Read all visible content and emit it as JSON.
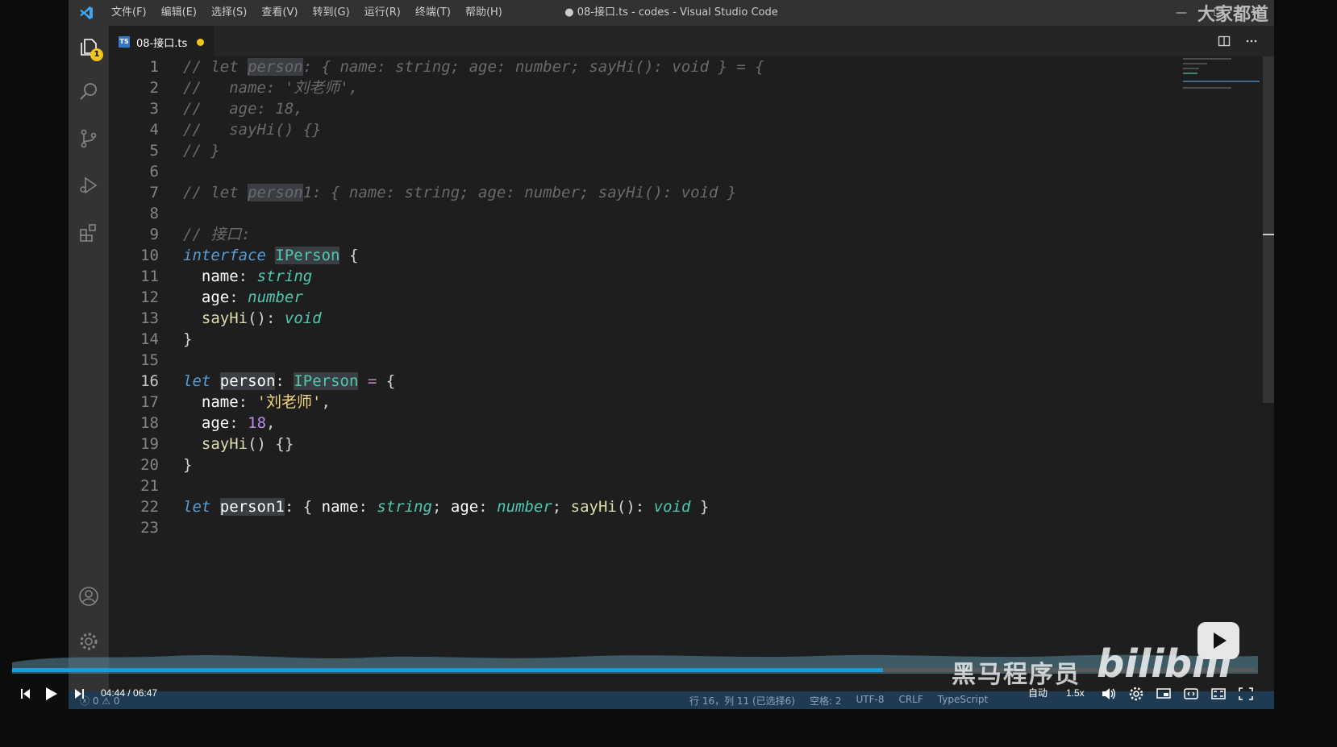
{
  "window": {
    "title": "● 08-接口.ts - codes - Visual Studio Code",
    "menu": [
      "文件(F)",
      "编辑(E)",
      "选择(S)",
      "查看(V)",
      "转到(G)",
      "运行(R)",
      "终端(T)",
      "帮助(H)"
    ],
    "controls": {
      "minimize": "—",
      "restore": "❐",
      "close": "✕"
    }
  },
  "activity_bar": {
    "explorer_badge": "1",
    "items": [
      "files-icon",
      "search-icon",
      "source-control-icon",
      "run-debug-icon",
      "extensions-icon",
      "account-icon",
      "settings-gear-icon"
    ]
  },
  "tab": {
    "filename": "08-接口.ts",
    "file_icon": "TS",
    "modified": true
  },
  "editor": {
    "current_line": 16,
    "line_numbers": [
      "1",
      "2",
      "3",
      "4",
      "5",
      "6",
      "7",
      "8",
      "9",
      "10",
      "11",
      "12",
      "13",
      "14",
      "15",
      "16",
      "17",
      "18",
      "19",
      "20",
      "21",
      "22",
      "23"
    ],
    "lines": {
      "l1": {
        "a": "// let ",
        "b": "person",
        "c": ": { name: string; age: number; sayHi(): void } = {"
      },
      "l2": "//   name: '刘老师',",
      "l3": "//   age: 18,",
      "l4": "//   sayHi() {}",
      "l5": "// }",
      "l7": {
        "a": "// let ",
        "b": "person",
        "c": "1: { name: string; age: number; sayHi(): void }"
      },
      "l9": "// 接口:",
      "l10": {
        "kw": "interface",
        "name": "IPerson",
        "p": "{"
      },
      "l11": {
        "prop": "name",
        "colon": ":",
        "type": "string"
      },
      "l12": {
        "prop": "age",
        "colon": ":",
        "type": "number"
      },
      "l13": {
        "prop": "sayHi",
        "paren": "()",
        "colon": ":",
        "type": "void"
      },
      "l14": "}",
      "l16": {
        "kw": "let",
        "var": "person",
        "colon": ":",
        "type": "IPerson",
        "eq": "=",
        "brace": "{"
      },
      "l17": {
        "prop": "name",
        "colon": ":",
        "value": "'刘老师'",
        "comma": ","
      },
      "l18": {
        "prop": "age",
        "colon": ":",
        "value": "18",
        "comma": ","
      },
      "l19": {
        "fn": "sayHi",
        "rest": "() {}"
      },
      "l20": "}",
      "l22": {
        "kw": "let",
        "var": "person1",
        "c1": ":",
        "b1": "{",
        "p1": "name",
        "c2": ":",
        "t1": "string",
        "s1": ";",
        "p2": "age",
        "c3": ":",
        "t2": "number",
        "s2": ";",
        "p3": "sayHi",
        "pa": "()",
        "c4": ":",
        "t3": "void",
        "b2": "}"
      }
    }
  },
  "statusbar": {
    "problems": "ⓧ 0 ⚠ 0",
    "position": "行 16，列 11 (已选择6)",
    "spaces": "空格: 2",
    "encoding": "UTF-8",
    "eol": "CRLF",
    "language": "TypeScript"
  },
  "player": {
    "time_current": "04:44",
    "time_total": "06:47",
    "progress": 0.7,
    "quality": "自动",
    "speed": "1.5x",
    "watermark_cn": "黑马程序员",
    "watermark_brand": "bilibili",
    "top_watermark": "大家都道"
  }
}
